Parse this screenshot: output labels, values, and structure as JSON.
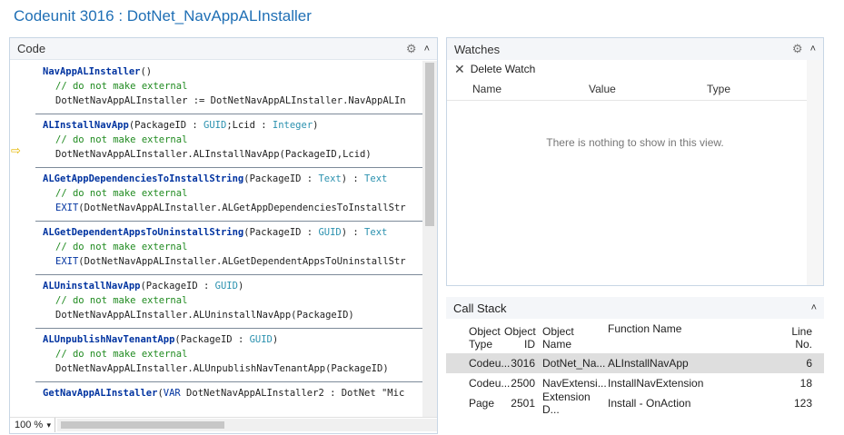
{
  "window": {
    "title": "Codeunit 3016 : DotNet_NavAppALInstaller"
  },
  "code_panel": {
    "title": "Code",
    "zoom": "100 %",
    "functions": [
      {
        "sig": [
          {
            "t": "kw",
            "v": "NavAppALInstaller"
          },
          {
            "t": "plain",
            "v": "()"
          }
        ],
        "lines": [
          [
            {
              "t": "comment",
              "v": "// do not make external"
            }
          ],
          [
            {
              "t": "plain",
              "v": "DotNetNavAppALInstaller := DotNetNavAppALInstaller.NavAppALIn"
            }
          ]
        ]
      },
      {
        "sig": [
          {
            "t": "kw",
            "v": "ALInstallNavApp"
          },
          {
            "t": "plain",
            "v": "(PackageID : "
          },
          {
            "t": "type",
            "v": "GUID"
          },
          {
            "t": "plain",
            "v": ";Lcid : "
          },
          {
            "t": "type",
            "v": "Integer"
          },
          {
            "t": "plain",
            "v": ")"
          }
        ],
        "lines": [
          [
            {
              "t": "comment",
              "v": "// do not make external"
            }
          ],
          [
            {
              "t": "plain",
              "v": "DotNetNavAppALInstaller.ALInstallNavApp(PackageID,Lcid)"
            }
          ]
        ]
      },
      {
        "sig": [
          {
            "t": "kw",
            "v": "ALGetAppDependenciesToInstallString"
          },
          {
            "t": "plain",
            "v": "(PackageID : "
          },
          {
            "t": "type",
            "v": "Text"
          },
          {
            "t": "plain",
            "v": ") : "
          },
          {
            "t": "type",
            "v": "Text"
          }
        ],
        "lines": [
          [
            {
              "t": "comment",
              "v": "// do not make external"
            }
          ],
          [
            {
              "t": "exit",
              "v": "EXIT"
            },
            {
              "t": "plain",
              "v": "(DotNetNavAppALInstaller.ALGetAppDependenciesToInstallStr"
            }
          ]
        ]
      },
      {
        "sig": [
          {
            "t": "kw",
            "v": "ALGetDependentAppsToUninstallString"
          },
          {
            "t": "plain",
            "v": "(PackageID : "
          },
          {
            "t": "type",
            "v": "GUID"
          },
          {
            "t": "plain",
            "v": ") : "
          },
          {
            "t": "type",
            "v": "Text"
          }
        ],
        "lines": [
          [
            {
              "t": "comment",
              "v": "// do not make external"
            }
          ],
          [
            {
              "t": "exit",
              "v": "EXIT"
            },
            {
              "t": "plain",
              "v": "(DotNetNavAppALInstaller.ALGetDependentAppsToUninstallStr"
            }
          ]
        ]
      },
      {
        "sig": [
          {
            "t": "kw",
            "v": "ALUninstallNavApp"
          },
          {
            "t": "plain",
            "v": "(PackageID : "
          },
          {
            "t": "type",
            "v": "GUID"
          },
          {
            "t": "plain",
            "v": ")"
          }
        ],
        "lines": [
          [
            {
              "t": "comment",
              "v": "// do not make external"
            }
          ],
          [
            {
              "t": "plain",
              "v": "DotNetNavAppALInstaller.ALUninstallNavApp(PackageID)"
            }
          ]
        ]
      },
      {
        "sig": [
          {
            "t": "kw",
            "v": "ALUnpublishNavTenantApp"
          },
          {
            "t": "plain",
            "v": "(PackageID : "
          },
          {
            "t": "type",
            "v": "GUID"
          },
          {
            "t": "plain",
            "v": ")"
          }
        ],
        "lines": [
          [
            {
              "t": "comment",
              "v": "// do not make external"
            }
          ],
          [
            {
              "t": "plain",
              "v": "DotNetNavAppALInstaller.ALUnpublishNavTenantApp(PackageID)"
            }
          ]
        ]
      },
      {
        "sig": [
          {
            "t": "kw",
            "v": "GetNavAppALInstaller"
          },
          {
            "t": "plain",
            "v": "("
          },
          {
            "t": "exit",
            "v": "VAR"
          },
          {
            "t": "plain",
            "v": " DotNetNavAppALInstaller2 : DotNet \"Mic"
          }
        ],
        "lines": []
      }
    ]
  },
  "watches": {
    "title": "Watches",
    "delete_label": "Delete Watch",
    "columns": [
      "Name",
      "Value",
      "Type"
    ],
    "empty_message": "There is nothing to show in this view."
  },
  "call_stack": {
    "title": "Call Stack",
    "columns": [
      [
        "Object",
        "Type"
      ],
      [
        "Object",
        "ID"
      ],
      [
        "Object",
        "Name"
      ],
      [
        "Function Name"
      ],
      [
        "Line",
        "No."
      ]
    ],
    "rows": [
      {
        "type": "Codeu...",
        "id": "3016",
        "name": "DotNet_Na...",
        "function": "ALInstallNavApp",
        "line": "6",
        "selected": true
      },
      {
        "type": "Codeu...",
        "id": "2500",
        "name": "NavExtensi...",
        "function": "InstallNavExtension",
        "line": "18",
        "selected": false
      },
      {
        "type": "Page",
        "id": "2501",
        "name": "Extension D...",
        "function": "Install - OnAction",
        "line": "123",
        "selected": false
      }
    ]
  }
}
